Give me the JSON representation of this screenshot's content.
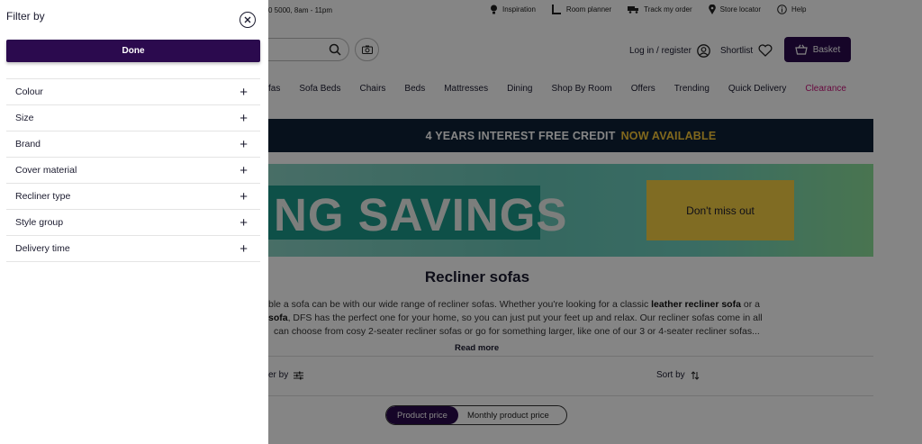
{
  "topbar": {
    "phone": "0 5000, 8am - 11pm",
    "links": [
      "Inspiration",
      "Room planner",
      "Track my order",
      "Store locator",
      "Help"
    ]
  },
  "header": {
    "login": "Log in / register",
    "shortlist": "Shortlist",
    "basket": "Basket"
  },
  "nav": {
    "items": [
      "fas",
      "Sofa Beds",
      "Chairs",
      "Beds",
      "Mattresses",
      "Dining",
      "Shop By Room",
      "Offers",
      "Trending",
      "Quick Delivery",
      "Clearance"
    ]
  },
  "promo": {
    "text": "4 YEARS INTEREST FREE CREDIT",
    "highlight": "NOW AVAILABLE"
  },
  "banner": {
    "headline": "NG SAVINGS",
    "cta": "Don't miss out"
  },
  "main": {
    "title": "Recliner sofas",
    "intro_line1_a": "ble a sofa can be with our wide range of recliner sofas. Whether you're looking for a classic ",
    "intro_line1_b": "leather recliner sofa",
    "intro_line1_c": " or a",
    "intro_line2_a": "sofa",
    "intro_line2_b": ", DFS has the perfect one for your home, so you can just put your feet up and relax. Our recliner sofas come in all",
    "intro_line3": "can choose from cosy 2-seater recliner sofas or go for something larger, like one of our 3 or 4-seater recliner sofas...",
    "read_more": "Read more",
    "filter_by": "er by",
    "sort_by": "Sort by",
    "price_toggle": [
      "Product price",
      "Monthly product price"
    ]
  },
  "drawer": {
    "title": "Filter by",
    "done": "Done",
    "filters": [
      "Colour",
      "Size",
      "Brand",
      "Cover material",
      "Recliner type",
      "Style group",
      "Delivery time"
    ]
  },
  "colors": {
    "brand_purple": "#2b0a4e",
    "clearance": "#c8157a",
    "promo_bg": "#0e2236",
    "promo_highlight": "#f7c739",
    "cta_yellow": "#f6cf43"
  }
}
